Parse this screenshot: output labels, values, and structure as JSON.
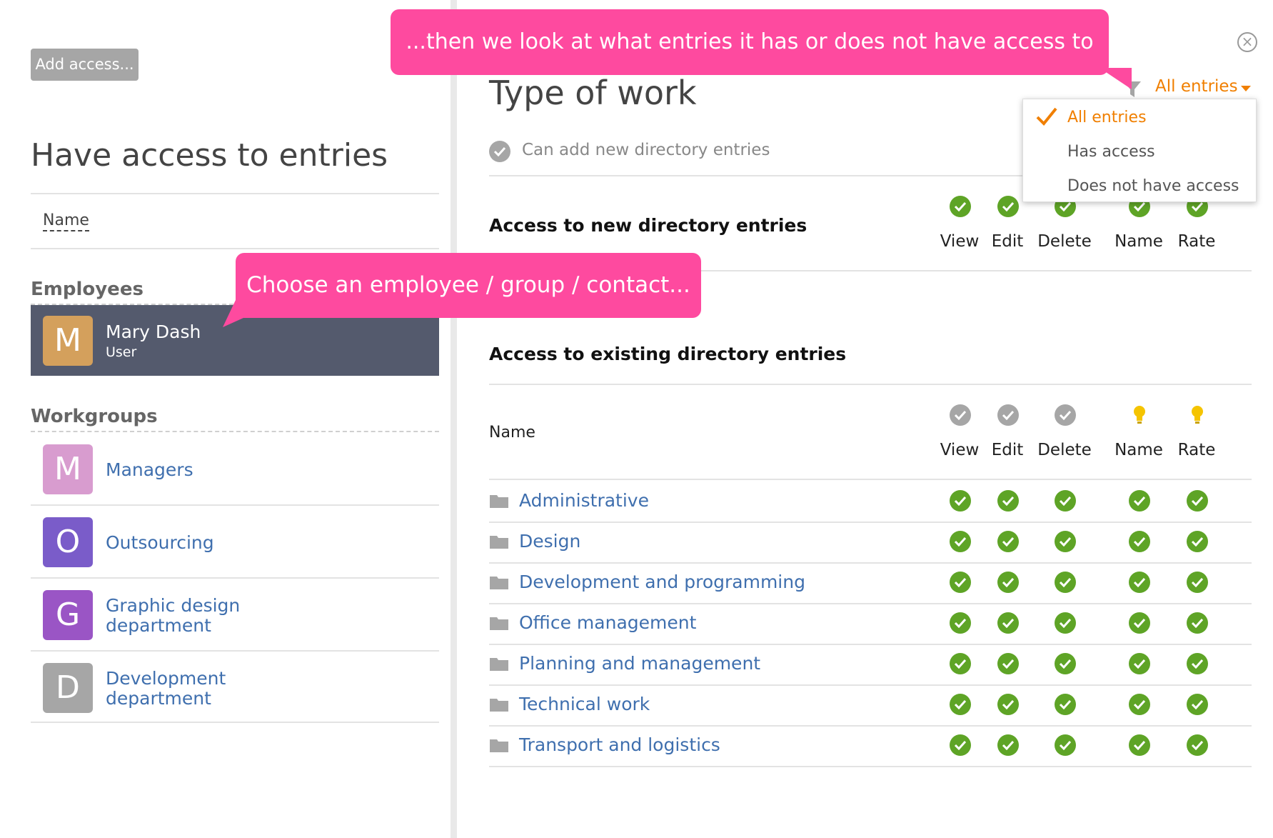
{
  "left_panel": {
    "add_button": "Add access...",
    "heading": "Have access to entries",
    "name_column": "Name",
    "employees_label": "Employees",
    "employee": {
      "initial": "M",
      "name": "Mary Dash",
      "role": "User",
      "color": "#d4a05c"
    },
    "workgroups_label": "Workgroups",
    "workgroups": [
      {
        "initial": "M",
        "name": "Managers",
        "color": "#d89ccf"
      },
      {
        "initial": "O",
        "name": "Outsourcing",
        "color": "#7a5cc9"
      },
      {
        "initial": "G",
        "name": "Graphic design department",
        "color": "#9a55c5"
      },
      {
        "initial": "D",
        "name": "Development department",
        "color": "#a6a6a6"
      }
    ]
  },
  "right_panel": {
    "title": "Type of work",
    "filter": {
      "label": "All entries",
      "icon": "filter-icon"
    },
    "dropdown": {
      "items": [
        "All entries",
        "Has access",
        "Does not have access"
      ],
      "selected": "All entries"
    },
    "can_add_label": "Can add new directory entries",
    "new_section_title": "Access to new directory entries",
    "existing_section_title": "Access to existing directory entries",
    "columns": [
      "View",
      "Edit",
      "Delete",
      "Name",
      "Rate"
    ],
    "name_header": "Name",
    "entries": [
      "Administrative",
      "Design",
      "Development and programming",
      "Office management",
      "Planning and management",
      "Technical work",
      "Transport and logistics"
    ]
  },
  "callouts": {
    "top": "...then we look at what entries it has or does not have access to",
    "middle": "Choose an employee / group / contact..."
  },
  "colors": {
    "accent": "#f07f00",
    "check": "#5ea426",
    "callout": "#fe4a9f",
    "link": "#3f6fae"
  }
}
